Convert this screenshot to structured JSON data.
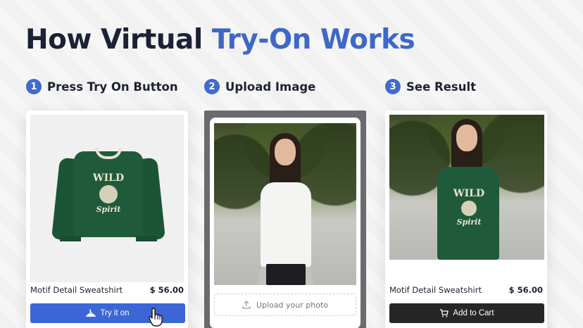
{
  "headline": {
    "part1": "How Virtual ",
    "part2": "Try-On Works"
  },
  "steps": [
    {
      "number": "1",
      "label": "Press Try On Button"
    },
    {
      "number": "2",
      "label": "Upload Image"
    },
    {
      "number": "3",
      "label": "See Result"
    }
  ],
  "card1": {
    "product_name": "Motif Detail Sweatshirt",
    "price": "$ 56.00",
    "button_label": "Try it on",
    "print_text": "WILD",
    "print_text2": "Spirit"
  },
  "card2": {
    "upload_label": "Upload your photo"
  },
  "card3": {
    "product_name": "Motif Detail Sweatshirt",
    "price": "$ 56.00",
    "button_label": "Add to Cart",
    "print_text": "WILD",
    "print_text2": "Spirit"
  },
  "colors": {
    "accent_blue": "#3e68c7",
    "dark_text": "#1b2236",
    "cart_button": "#262626"
  }
}
